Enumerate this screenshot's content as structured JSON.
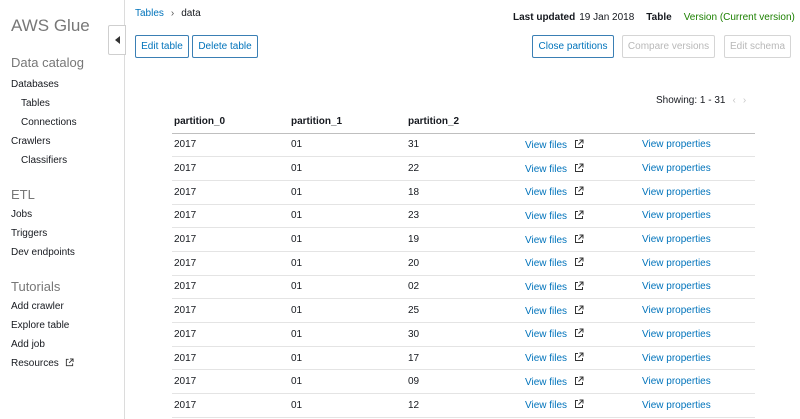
{
  "sidebar": {
    "brand": "AWS Glue",
    "sections": {
      "data_catalog": "Data catalog",
      "etl": "ETL",
      "tutorials": "Tutorials"
    },
    "items": {
      "databases": "Databases",
      "tables": "Tables",
      "connections": "Connections",
      "crawlers": "Crawlers",
      "classifiers": "Classifiers",
      "jobs": "Jobs",
      "triggers": "Triggers",
      "dev_endpoints": "Dev endpoints",
      "add_crawler": "Add crawler",
      "explore_table": "Explore table",
      "add_job": "Add job",
      "resources": "Resources"
    }
  },
  "breadcrumb": {
    "parent": "Tables",
    "separator": "›",
    "current": "data"
  },
  "header": {
    "last_updated_label": "Last updated",
    "last_updated_value": "19 Jan 2018",
    "table_label": "Table",
    "version_label": "Version (Current version)"
  },
  "toolbar": {
    "edit_table": "Edit table",
    "delete_table": "Delete table",
    "close_partitions": "Close partitions",
    "compare_versions": "Compare versions",
    "edit_schema": "Edit schema"
  },
  "pagination": {
    "showing": "Showing: 1 - 31",
    "prev": "‹",
    "next": "›"
  },
  "partitions": {
    "columns": [
      "partition_0",
      "partition_1",
      "partition_2"
    ],
    "view_files_label": "View files",
    "view_properties_label": "View properties",
    "rows": [
      [
        "2017",
        "01",
        "31"
      ],
      [
        "2017",
        "01",
        "22"
      ],
      [
        "2017",
        "01",
        "18"
      ],
      [
        "2017",
        "01",
        "23"
      ],
      [
        "2017",
        "01",
        "19"
      ],
      [
        "2017",
        "01",
        "20"
      ],
      [
        "2017",
        "01",
        "02"
      ],
      [
        "2017",
        "01",
        "25"
      ],
      [
        "2017",
        "01",
        "30"
      ],
      [
        "2017",
        "01",
        "17"
      ],
      [
        "2017",
        "01",
        "09"
      ],
      [
        "2017",
        "01",
        "12"
      ]
    ]
  }
}
